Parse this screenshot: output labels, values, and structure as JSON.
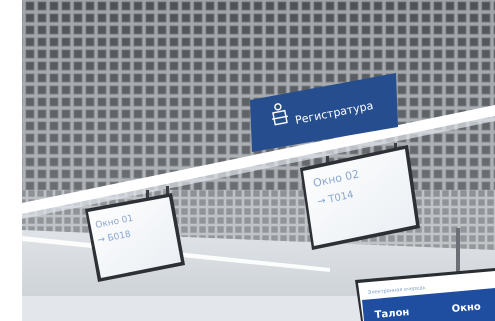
{
  "sign": {
    "registry_label": "Регистратура",
    "registry_bg": "#264e8f"
  },
  "monitors": {
    "window_01": {
      "title": "Окно 01",
      "ticket_line": "→ Б018"
    },
    "window_02": {
      "title": "Окно 02",
      "ticket_line": "→ Т014"
    }
  },
  "queue_board": {
    "caption": "Электронная очередь",
    "col_ticket": "Талон",
    "col_window": "Окно",
    "header_bg": "#1f4ea1"
  },
  "icons": {
    "registry_sign_icon": "reception-desk-person-icon"
  }
}
